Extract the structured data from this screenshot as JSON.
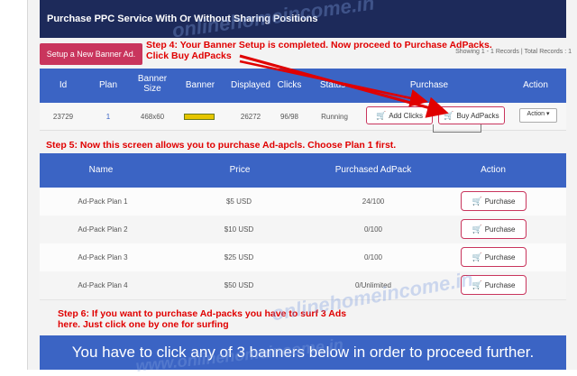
{
  "header": {
    "title": "Purchase PPC Service With Or Without Sharing Positions"
  },
  "toolbar": {
    "new_banner_label": "Setup a New Banner Ad.",
    "showing_text": "Showing 1 - 1 Records | Total Records : 1"
  },
  "annotations": {
    "step4_line1": "Step 4: Your Banner Setup is completed. Now proceed to Purchase AdPacks.",
    "step4_line2": "Click Buy AdPacks",
    "step5": "Step 5: Now this screen allows you to purchase Ad-apcls. Choose Plan 1 first.",
    "step6_line1": "Step 6: If you want to purchase Ad-packs you have to surf 3 Ads",
    "step6_line2": "here. Just click one by one for surfing"
  },
  "banner_table": {
    "headers": {
      "id": "Id",
      "plan": "Plan",
      "banner_size_1": "Banner",
      "banner_size_2": "Size",
      "banner": "Banner",
      "displayed": "Displayed",
      "clicks": "Clicks",
      "status": "Status",
      "purchase": "Purchase",
      "action": "Action"
    },
    "row": {
      "id": "23729",
      "plan": "1",
      "banner_size": "468x60",
      "displayed": "26272",
      "clicks": "96/98",
      "status": "Running",
      "add_clicks": "Add Clicks",
      "buy_adpacks": "Buy AdPacks",
      "action": "Action"
    }
  },
  "plans_table": {
    "headers": {
      "name": "Name",
      "price": "Price",
      "purchased": "Purchased AdPack",
      "action": "Action"
    },
    "rows": [
      {
        "name": "Ad-Pack Plan 1",
        "price": "$5 USD",
        "purchased": "24/100",
        "button": "Purchase"
      },
      {
        "name": "Ad-Pack Plan 2",
        "price": "$10 USD",
        "purchased": "0/100",
        "button": "Purchase"
      },
      {
        "name": "Ad-Pack Plan 3",
        "price": "$25 USD",
        "purchased": "0/100",
        "button": "Purchase"
      },
      {
        "name": "Ad-Pack Plan 4",
        "price": "$50 USD",
        "purchased": "0/Unlimited",
        "button": "Purchase"
      }
    ]
  },
  "footer": {
    "banner_text": "You have to click any of 3 banners below in order to proceed further."
  },
  "watermark": {
    "text1": "onlinehomeincome.in",
    "text2": "www.onlinehomeincome.in"
  },
  "colors": {
    "header_navy": "#1d2a5a",
    "table_blue": "#3b64c4",
    "accent_pink": "#c9355d",
    "annotation_red": "#e00000"
  },
  "icons": {
    "cart": "shopping-cart-icon",
    "caret": "caret-down-icon"
  }
}
